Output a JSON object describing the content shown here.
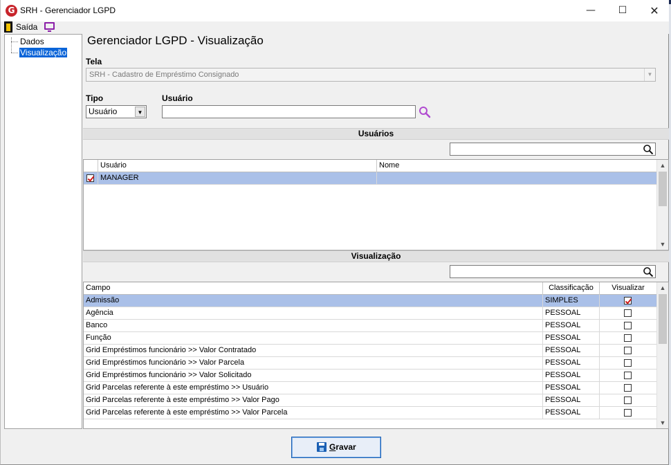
{
  "window": {
    "title": "SRH - Gerenciador LGPD",
    "logo_letter": "G"
  },
  "toolbar": {
    "exit_label": "Saída"
  },
  "tree": {
    "items": [
      "Dados",
      "Visualização"
    ],
    "selected": "Visualização"
  },
  "page": {
    "title": "Gerenciador LGPD - Visualização"
  },
  "form": {
    "tela_label": "Tela",
    "tela_value": "SRH - Cadastro de Empréstimo Consignado",
    "tipo_label": "Tipo",
    "tipo_value": "Usuário",
    "usuario_label": "Usuário",
    "usuario_value": ""
  },
  "users_section": {
    "title": "Usuários",
    "filter_value": "",
    "columns": [
      "Usuário",
      "Nome"
    ],
    "rows": [
      {
        "checked": true,
        "usuario": "MANAGER",
        "nome": ""
      }
    ]
  },
  "view_section": {
    "title": "Visualização",
    "filter_value": "",
    "columns": [
      "Campo",
      "Classificação",
      "Visualizar"
    ],
    "rows": [
      {
        "campo": "Admissão",
        "classificacao": "SIMPLES",
        "visualizar": true
      },
      {
        "campo": "Agência",
        "classificacao": "PESSOAL",
        "visualizar": false
      },
      {
        "campo": "Banco",
        "classificacao": "PESSOAL",
        "visualizar": false
      },
      {
        "campo": "Função",
        "classificacao": "PESSOAL",
        "visualizar": false
      },
      {
        "campo": "Grid Empréstimos funcionário >> Valor Contratado",
        "classificacao": "PESSOAL",
        "visualizar": false
      },
      {
        "campo": "Grid Empréstimos funcionário >> Valor Parcela",
        "classificacao": "PESSOAL",
        "visualizar": false
      },
      {
        "campo": "Grid Empréstimos funcionário >> Valor Solicitado",
        "classificacao": "PESSOAL",
        "visualizar": false
      },
      {
        "campo": "Grid Parcelas referente à este empréstimo >> Usuário",
        "classificacao": "PESSOAL",
        "visualizar": false
      },
      {
        "campo": "Grid Parcelas referente à este empréstimo >> Valor Pago",
        "classificacao": "PESSOAL",
        "visualizar": false
      },
      {
        "campo": "Grid Parcelas referente à este empréstimo >> Valor Parcela",
        "classificacao": "PESSOAL",
        "visualizar": false
      }
    ]
  },
  "footer": {
    "save_hotkey": "G",
    "save_rest": "ravar"
  },
  "colors": {
    "selection": "#aac0e8",
    "tree_selection": "#0a64d8",
    "accent": "#1a5fb4",
    "check": "#d01818"
  },
  "icons": [
    "app-logo-icon",
    "exit-door-icon",
    "monitor-icon",
    "search-icon",
    "save-disk-icon"
  ]
}
